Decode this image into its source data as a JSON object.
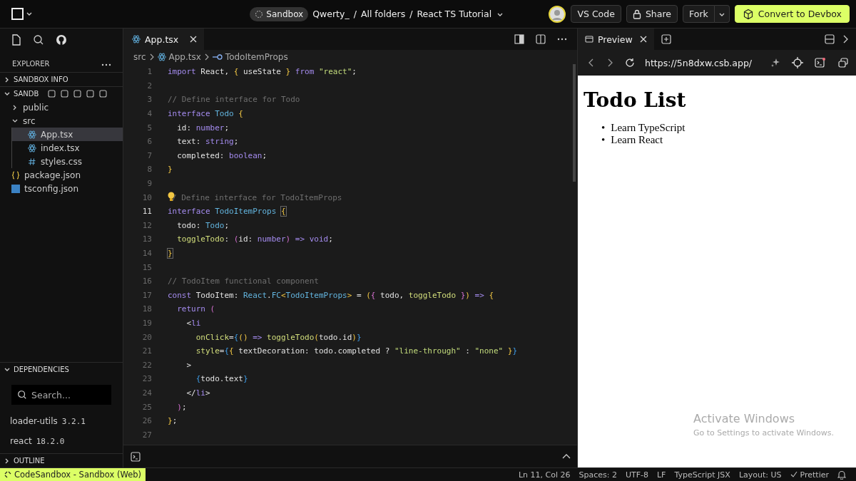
{
  "topbar": {
    "badge": "Sandbox",
    "path": [
      "Qwerty_",
      "/",
      "All folders",
      "/",
      "React TS Tutorial"
    ],
    "buttons": [
      {
        "label": "VS Code",
        "kind": "plain"
      },
      {
        "label": "Share",
        "kind": "lock"
      },
      {
        "label": "Fork",
        "kind": "split"
      },
      {
        "label": "Convert to Devbox",
        "kind": "primary"
      }
    ]
  },
  "sidebar": {
    "title": "EXPLORER",
    "sections": [
      {
        "label": "SANDBOX INFO",
        "expanded": false
      },
      {
        "label": "SANDB",
        "expanded": true
      }
    ],
    "tree": [
      {
        "name": "public",
        "kind": "folder",
        "expanded": false,
        "selected": false
      },
      {
        "name": "src",
        "kind": "folder",
        "expanded": true,
        "selected": false,
        "children": [
          {
            "name": "App.tsx",
            "kind": "react",
            "selected": true
          },
          {
            "name": "index.tsx",
            "kind": "react",
            "selected": false
          },
          {
            "name": "styles.css",
            "kind": "css",
            "selected": false
          }
        ]
      },
      {
        "name": "package.json",
        "kind": "json",
        "selected": false
      },
      {
        "name": "tsconfig.json",
        "kind": "ts",
        "selected": false
      }
    ],
    "dependencies": {
      "label": "DEPENDENCIES",
      "expanded": true,
      "search": {
        "placeholder": "Search..."
      },
      "items": [
        {
          "name": "loader-utils",
          "version": "3.2.1"
        },
        {
          "name": "react",
          "version": "18.2.0"
        }
      ]
    },
    "outline": {
      "label": "OUTLINE",
      "expanded": false
    }
  },
  "editor": {
    "tab": "App.tsx",
    "breadcrumb": [
      "src",
      "App.tsx",
      "TodoItemProps"
    ],
    "lines": [
      {
        "number": "1",
        "selected": false,
        "tokens": [
          {
            "text": "import",
            "kind": "keyword"
          },
          {
            "text": " React, ",
            "kind": "plain"
          },
          {
            "text": "{",
            "kind": "brace"
          },
          {
            "text": " useState ",
            "kind": "plain"
          },
          {
            "text": "}",
            "kind": "brace"
          },
          {
            "text": " from ",
            "kind": "keyword"
          },
          {
            "text": "\"react\"",
            "kind": "string"
          },
          {
            "text": ";",
            "kind": "plain"
          }
        ]
      },
      {
        "number": "2",
        "selected": false
      },
      {
        "number": "3",
        "selected": false,
        "tokens": [
          {
            "text": "// Define interface for Todo",
            "kind": "comment"
          }
        ]
      },
      {
        "number": "4",
        "selected": false,
        "tokens": [
          {
            "text": "interface ",
            "kind": "keyword"
          },
          {
            "text": "Todo ",
            "kind": "type"
          },
          {
            "text": "{",
            "kind": "brace"
          }
        ]
      },
      {
        "number": "5",
        "selected": false,
        "tokens": [
          {
            "text": "  id: ",
            "kind": "plain"
          },
          {
            "text": "number",
            "kind": "keyword"
          },
          {
            "text": ";",
            "kind": "plain"
          }
        ]
      },
      {
        "number": "6",
        "selected": false,
        "tokens": [
          {
            "text": "  text: ",
            "kind": "plain"
          },
          {
            "text": "string",
            "kind": "keyword"
          },
          {
            "text": ";",
            "kind": "plain"
          }
        ]
      },
      {
        "number": "7",
        "selected": false,
        "tokens": [
          {
            "text": "  completed: ",
            "kind": "plain"
          },
          {
            "text": "boolean",
            "kind": "keyword"
          },
          {
            "text": ";",
            "kind": "plain"
          }
        ]
      },
      {
        "number": "8",
        "selected": false,
        "tokens": [
          {
            "text": "}",
            "kind": "brace"
          }
        ]
      },
      {
        "number": "9",
        "selected": false
      },
      {
        "number": "10",
        "selected": false,
        "bulb": true,
        "tokens": [
          {
            "text": "/ Define interface for TodoItemProps",
            "kind": "comment"
          }
        ]
      },
      {
        "number": "11",
        "selected": true,
        "tokens": [
          {
            "text": "interface ",
            "kind": "keyword"
          },
          {
            "text": "TodoItemProps ",
            "kind": "type"
          },
          {
            "text": "{",
            "kind": "match"
          }
        ]
      },
      {
        "number": "12",
        "selected": false,
        "tokens": [
          {
            "text": "  todo: ",
            "kind": "plain"
          },
          {
            "text": "Todo",
            "kind": "type"
          },
          {
            "text": ";",
            "kind": "plain"
          }
        ]
      },
      {
        "number": "13",
        "selected": false,
        "tokens": [
          {
            "text": "  toggleTodo",
            "kind": "func"
          },
          {
            "text": ": ",
            "kind": "plain"
          },
          {
            "text": "(",
            "kind": "paren"
          },
          {
            "text": "id: ",
            "kind": "plain"
          },
          {
            "text": "number",
            "kind": "keyword"
          },
          {
            "text": ")",
            "kind": "paren"
          },
          {
            "text": " => ",
            "kind": "keyword"
          },
          {
            "text": "void",
            "kind": "keyword"
          },
          {
            "text": ";",
            "kind": "plain"
          }
        ]
      },
      {
        "number": "14",
        "selected": false,
        "tokens": [
          {
            "text": "}",
            "kind": "match"
          }
        ]
      },
      {
        "number": "15",
        "selected": false
      },
      {
        "number": "16",
        "selected": false,
        "tokens": [
          {
            "text": "// TodoItem functional component",
            "kind": "comment"
          }
        ]
      },
      {
        "number": "17",
        "selected": false,
        "tokens": [
          {
            "text": "const ",
            "kind": "keyword"
          },
          {
            "text": "TodoItem: ",
            "kind": "plain"
          },
          {
            "text": "React",
            "kind": "type"
          },
          {
            "text": ".",
            "kind": "plain"
          },
          {
            "text": "FC",
            "kind": "type"
          },
          {
            "text": "<",
            "kind": "brace"
          },
          {
            "text": "TodoItemProps",
            "kind": "type"
          },
          {
            "text": ">",
            "kind": "brace"
          },
          {
            "text": " = ",
            "kind": "plain"
          },
          {
            "text": "(",
            "kind": "brace"
          },
          {
            "text": "{",
            "kind": "paren"
          },
          {
            "text": " todo, ",
            "kind": "plain"
          },
          {
            "text": "toggleTodo ",
            "kind": "func"
          },
          {
            "text": "}",
            "kind": "paren"
          },
          {
            "text": ")",
            "kind": "brace"
          },
          {
            "text": " => ",
            "kind": "keyword"
          },
          {
            "text": "{",
            "kind": "brace"
          }
        ]
      },
      {
        "number": "18",
        "selected": false,
        "tokens": [
          {
            "text": "  return ",
            "kind": "keyword"
          },
          {
            "text": "(",
            "kind": "paren"
          }
        ]
      },
      {
        "number": "19",
        "selected": false,
        "tokens": [
          {
            "text": "    <",
            "kind": "plain"
          },
          {
            "text": "li",
            "kind": "keyword"
          }
        ]
      },
      {
        "number": "20",
        "selected": false,
        "tokens": [
          {
            "text": "      onClick",
            "kind": "func"
          },
          {
            "text": "=",
            "kind": "plain"
          },
          {
            "text": "{",
            "kind": "jsx"
          },
          {
            "text": "()",
            "kind": "brace"
          },
          {
            "text": " => ",
            "kind": "keyword"
          },
          {
            "text": "toggleTodo",
            "kind": "func"
          },
          {
            "text": "(",
            "kind": "brace"
          },
          {
            "text": "todo.id",
            "kind": "plain"
          },
          {
            "text": ")",
            "kind": "brace"
          },
          {
            "text": "}",
            "kind": "jsx"
          }
        ]
      },
      {
        "number": "21",
        "selected": false,
        "tokens": [
          {
            "text": "      style",
            "kind": "func"
          },
          {
            "text": "=",
            "kind": "plain"
          },
          {
            "text": "{",
            "kind": "jsx"
          },
          {
            "text": "{",
            "kind": "brace"
          },
          {
            "text": " textDecoration: todo.completed ? ",
            "kind": "plain"
          },
          {
            "text": "\"line-through\"",
            "kind": "string"
          },
          {
            "text": " : ",
            "kind": "plain"
          },
          {
            "text": "\"none\"",
            "kind": "string"
          },
          {
            "text": " }",
            "kind": "brace"
          },
          {
            "text": "}",
            "kind": "jsx"
          }
        ]
      },
      {
        "number": "22",
        "selected": false,
        "tokens": [
          {
            "text": "    >",
            "kind": "plain"
          }
        ]
      },
      {
        "number": "23",
        "selected": false,
        "tokens": [
          {
            "text": "      {",
            "kind": "jsx"
          },
          {
            "text": "todo.text",
            "kind": "plain"
          },
          {
            "text": "}",
            "kind": "jsx"
          }
        ]
      },
      {
        "number": "24",
        "selected": false,
        "tokens": [
          {
            "text": "    </",
            "kind": "plain"
          },
          {
            "text": "li",
            "kind": "keyword"
          },
          {
            "text": ">",
            "kind": "plain"
          }
        ]
      },
      {
        "number": "25",
        "selected": false,
        "tokens": [
          {
            "text": "  )",
            "kind": "paren"
          },
          {
            "text": ";",
            "kind": "plain"
          }
        ]
      },
      {
        "number": "26",
        "selected": false,
        "tokens": [
          {
            "text": "}",
            "kind": "brace"
          },
          {
            "text": ";",
            "kind": "plain"
          }
        ]
      },
      {
        "number": "27",
        "selected": false
      }
    ]
  },
  "preview": {
    "tab": "Preview",
    "url": "https://5n8dxw.csb.app/",
    "page": {
      "heading": "Todo List",
      "items": [
        {
          "marker": "•",
          "text": "Learn TypeScript"
        },
        {
          "marker": "•",
          "text": "Learn React"
        }
      ]
    }
  },
  "activation": {
    "title": "Activate Windows",
    "hint": "Go to Settings to activate Windows."
  },
  "status_bar": {
    "remote": "CodeSandbox - Sandbox (Web)",
    "items": [
      {
        "text": "Ln 11, Col 26",
        "kind": "text"
      },
      {
        "text": "Spaces: 2",
        "kind": "text"
      },
      {
        "text": "UTF-8",
        "kind": "text"
      },
      {
        "text": "LF",
        "kind": "text"
      },
      {
        "text": "TypeScript JSX",
        "kind": "text"
      },
      {
        "text": "Layout: US",
        "kind": "text"
      },
      {
        "text": "Prettier",
        "kind": "check"
      }
    ]
  }
}
